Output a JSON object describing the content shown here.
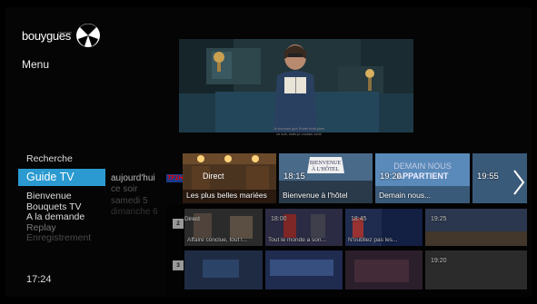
{
  "brand": {
    "name": "bouygues",
    "sub": "TELECOM"
  },
  "menu": {
    "title": "Menu"
  },
  "nav": {
    "search": "Recherche",
    "active": "Guide TV",
    "items": [
      "Bienvenue",
      "Bouquets TV",
      "A la demande",
      "Replay",
      "Enregistrement"
    ]
  },
  "days": [
    "aujourd'hui",
    "ce soir",
    "samedi 5",
    "dimanche 6"
  ],
  "clock": "17:24",
  "subtitles": [
    "Je pensais que l'hôtel était plein",
    "ce soir, mais je voulais venir"
  ],
  "row1": {
    "channel_logo": {
      "text_a": "TF1",
      "text_b": "HD"
    },
    "tiles": [
      {
        "direct": "Direct",
        "label": "Les plus belles mariées"
      },
      {
        "time": "18:15",
        "sign_a": "BIENVENUE",
        "sign_b": "À L'HÔTEL",
        "label": "Bienvenue à l'hôtel"
      },
      {
        "time": "19:20",
        "sign_a": "DEMAIN NOUS",
        "sign_b": "APPARTIENT",
        "label": "Demain nous..."
      },
      {
        "time": "19:55",
        "label": ""
      }
    ]
  },
  "row2": {
    "channel_num": "2",
    "tiles": [
      {
        "direct": "Direct",
        "label": "Affaire conclue, tout l..."
      },
      {
        "time": "18:00",
        "label": "Tout le monde a son..."
      },
      {
        "time": "18:45",
        "label": "N'oubliez pas les..."
      },
      {
        "time": "19:25",
        "label": ""
      }
    ]
  },
  "row3": {
    "channel_num": "3",
    "tiles": [
      {
        "time": "",
        "label": ""
      },
      {
        "time": "",
        "label": ""
      },
      {
        "time": "",
        "label": ""
      },
      {
        "time": "19:20",
        "label": ""
      }
    ]
  },
  "colors": {
    "accent": "#2a9ad0",
    "background": "#000000"
  },
  "icons": {
    "next": "chevron-right-icon",
    "logo": "bouygues-logo-icon"
  }
}
